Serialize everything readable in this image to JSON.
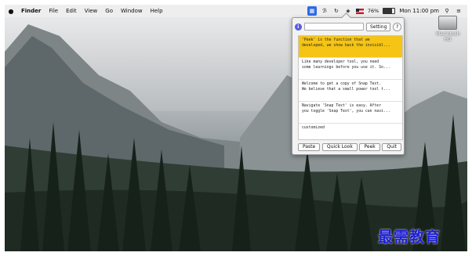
{
  "menubar": {
    "app_menu": "Finder",
    "items": [
      "File",
      "Edit",
      "View",
      "Go",
      "Window",
      "Help"
    ],
    "battery_percent": "76%",
    "battery_level": 0.76,
    "clock": "Mon 11:00 pm"
  },
  "desktop": {
    "drive_label": "Macintosh HD"
  },
  "popup": {
    "settings_label": "Setting",
    "help_label": "?",
    "info_label": "i",
    "snippets": [
      {
        "line1": "'Peek' is the function that we",
        "line2": "developed, we show back the invisibl..."
      },
      {
        "line1": "Like many developer tool, you need",
        "line2": "some learnings before you use it. So..."
      },
      {
        "line1": "Welcome to get a copy of Snap Text.",
        "line2": "We believe that a small power tool t..."
      },
      {
        "line1": "Navigate 'Snap Text' is easy. After",
        "line2": "you toggle 'Snap Text', you can navi..."
      },
      {
        "line1": "customized",
        "line2": ""
      }
    ],
    "buttons": {
      "paste": "Paste",
      "quick_look": "Quick Look",
      "peek": "Peek",
      "quit": "Quit"
    }
  },
  "watermark": "最需教育",
  "colors": {
    "selected_snippet": "#f5c414",
    "active_status_icon": "#2d6be4",
    "watermark": "#1d1fd6"
  },
  "icons": {
    "menubar_right": [
      "snap-text-icon",
      "bluetooth-icon",
      "time-machine-icon",
      "wifi-icon",
      "flag-icon",
      "battery-icon",
      "search-icon",
      "list-icon"
    ]
  }
}
